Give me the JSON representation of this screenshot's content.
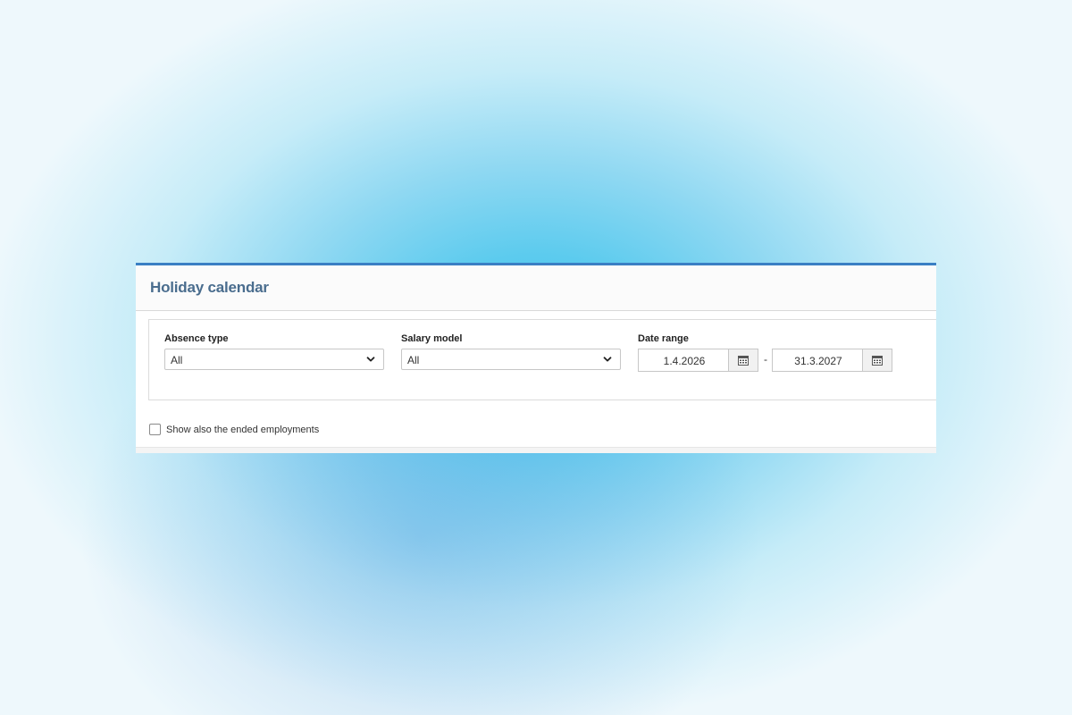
{
  "panel": {
    "title": "Holiday calendar"
  },
  "filters": {
    "absence_type": {
      "label": "Absence type",
      "value": "All"
    },
    "salary_model": {
      "label": "Salary model",
      "value": "All"
    },
    "date_range": {
      "label": "Date range",
      "start": "1.4.2026",
      "separator": "-",
      "end": "31.3.2027"
    }
  },
  "options": {
    "show_ended_employments_label": "Show also the ended employments",
    "show_ended_employments_checked": false
  },
  "icons": {
    "dropdown": "chevron-down-icon",
    "date_picker": "calendar-icon"
  },
  "colors": {
    "accent": "#3a7fc4",
    "title": "#4a6d8e"
  }
}
